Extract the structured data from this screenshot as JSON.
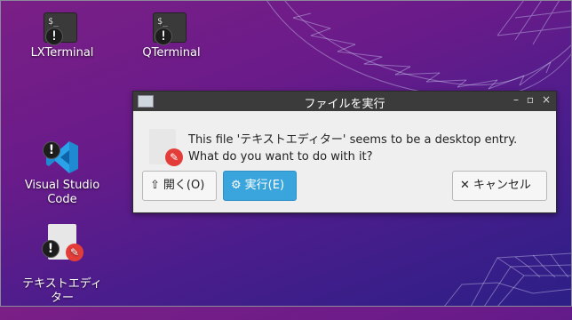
{
  "desktop": {
    "icons": [
      {
        "label": "LXTerminal",
        "glyph": "$_"
      },
      {
        "label": "QTerminal",
        "glyph": "$_"
      },
      {
        "label": "Visual Studio\nCode"
      },
      {
        "label": "テキストエディ\nター"
      }
    ]
  },
  "dialog": {
    "title": "ファイルを実行",
    "message_line1": "This file 'テキストエディター' seems to be a desktop entry.",
    "message_line2": "What do you want to do with it?",
    "open_label": "開く(O)",
    "run_label": "実行(E)",
    "cancel_label": "キャンセル",
    "controls": {
      "minimize": "–",
      "maximize": "▫",
      "close": "×"
    }
  },
  "colors": {
    "accent": "#3aa4dc",
    "warning": "#1d1d1d",
    "pencil": "#e33d3a"
  }
}
